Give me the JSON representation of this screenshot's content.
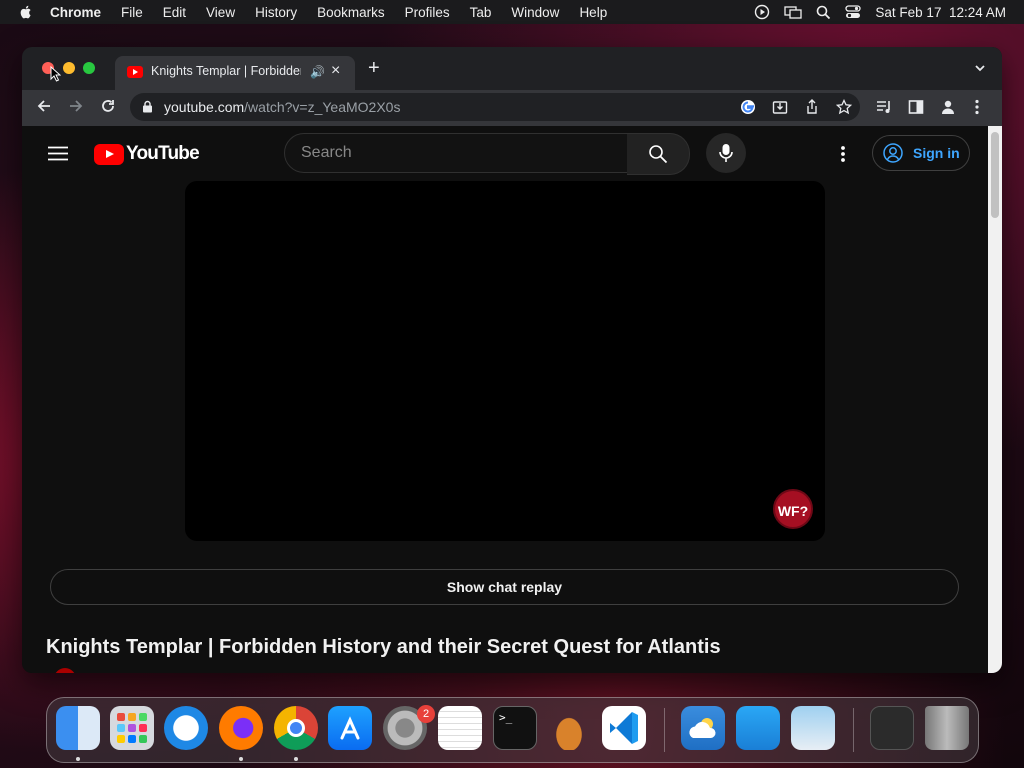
{
  "menubar": {
    "app_name": "Chrome",
    "menus": [
      "File",
      "Edit",
      "View",
      "History",
      "Bookmarks",
      "Profiles",
      "Tab",
      "Window",
      "Help"
    ],
    "datetime": "Sat Feb 17  12:24 AM"
  },
  "browser": {
    "tab_title": "Knights Templar | Forbidden History and their Secret Quest for Atlantis",
    "new_tab_label": "+",
    "url_host": "youtube.com",
    "url_path": "/watch?v=z_YeaMO2X0s"
  },
  "youtube": {
    "logo_text": "YouTube",
    "search_placeholder": "Search",
    "sign_in_label": "Sign in",
    "channel_badge_text": "WF?",
    "chat_replay_label": "Show chat replay",
    "video_title": "Knights Templar | Forbidden History and their Secret Quest for Atlantis"
  },
  "dock": {
    "apps": [
      "Finder",
      "Launchpad",
      "Safari",
      "Firefox",
      "Google Chrome",
      "App Store",
      "System Settings",
      "TextEdit",
      "Terminal",
      "GarageBand",
      "Visual Studio Code",
      "Weather",
      "Keynote",
      "Preview",
      "Downloads",
      "Trash"
    ],
    "system_settings_badge": "2"
  },
  "colors": {
    "youtube_red": "#ff0000",
    "link_blue": "#3ea6ff",
    "page_bg": "#0f0f0f"
  }
}
